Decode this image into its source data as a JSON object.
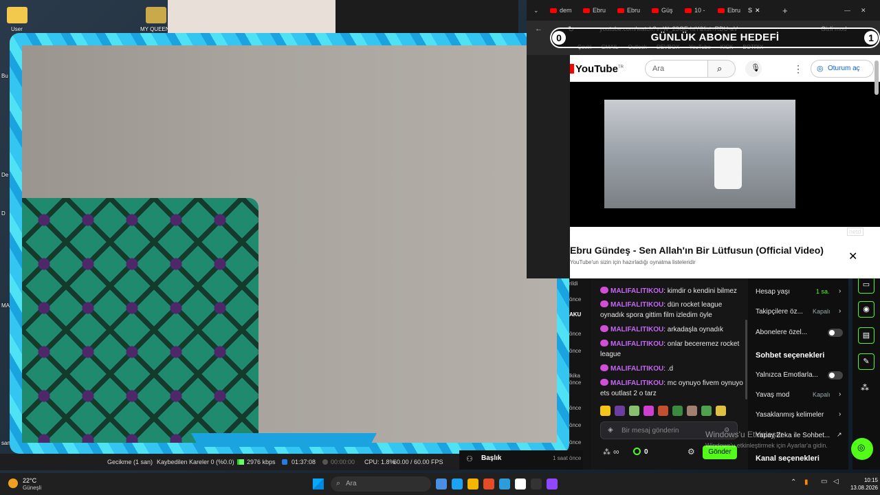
{
  "desktop": {
    "icon1_label": "User",
    "icon2_label": "MY QUEENS",
    "side_labels": [
      "Bu",
      "De",
      "D",
      "MA",
      "san"
    ]
  },
  "goal": {
    "left_count": "0",
    "title": "GÜNLÜK ABONE HEDEFİ",
    "right_count": "1"
  },
  "browser": {
    "tabs": [
      "dem",
      "Ebru",
      "Ebru",
      "Güş",
      "10 -",
      "Ebru",
      "S"
    ],
    "url": "youtube.com/watch?v=W_23GE-htY&list=RDU-aV",
    "profile": "Gizli mod",
    "bookmarks": [
      "Çeviri",
      "GMAIL",
      "Outlook",
      "DEVBOX",
      "YouTube",
      "KICK",
      "BOTRIX"
    ]
  },
  "youtube": {
    "logo": "YouTube",
    "region": "TR",
    "search_placeholder": "Ara",
    "signin": "Oturum aç",
    "watermark": "netd",
    "video_title": "Ebru Gündeş - Sen Allah'ın Bir Lütfusun (Official Video)",
    "mix_sub": "YouTube'un sizin için hazırladığı oynatma listeleridir"
  },
  "chat_strip": [
    "rildi",
    "önce",
    "AKU",
    "önce",
    "önce",
    "lkika",
    "önce",
    "önce",
    "önce",
    "önce"
  ],
  "chat": {
    "messages": [
      {
        "user": "MALIFALITIKOU",
        "text": ": kimdir o kendini bilmez"
      },
      {
        "user": "MALIFALITIKOU",
        "text": ": dün rocket league oynadık spora gittim film izledim öyle"
      },
      {
        "user": "MALIFALITIKOU",
        "text": ": arkadaşla oynadık"
      },
      {
        "user": "MALIFALITIKOU",
        "text": ": onlar beceremez rocket league"
      },
      {
        "user": "MALIFALITIKOU",
        "text": ": .d"
      },
      {
        "user": "MALIFALITIKOU",
        "text": ": mc oynuyo fivem oynuyo ets outlast 2 o tarz"
      }
    ],
    "emote_colors": [
      "#f5c518",
      "#6a3fa0",
      "#88c070",
      "#d040d0",
      "#c05030",
      "#3a8a40",
      "#a08070",
      "#50a050",
      "#e0c040"
    ],
    "input_placeholder": "Bir mesaj gönderin",
    "infinity": "∞",
    "points": "0",
    "send_label": "Gönder"
  },
  "settings": {
    "account_age_label": "Hesap yaşı",
    "account_age_value": "1 sa.",
    "followers_label": "Takipçilere öz...",
    "followers_value": "Kapalı",
    "subs_label": "Abonelere özel...",
    "chat_options_head": "Sohbet seçenekleri",
    "emote_only_label": "Yalnızca Emotlarla...",
    "slow_mode_label": "Yavaş mod",
    "slow_mode_value": "Kapalı",
    "banned_words_label": "Yasaklanmış kelimeler",
    "ai_label": "Yapay Zeka ile Sohbet...",
    "channel_options_head": "Kanal seçenekleri"
  },
  "titlebar": {
    "label": "Başlık",
    "time": "1 saat önce"
  },
  "obs": {
    "latency": "Gecikme (1 san)",
    "dropped": "Kaybedilen Kareler 0 (%0.0)",
    "bitrate": "2976 kbps",
    "live_time": "01:37:08",
    "rec_time": "00:00:00",
    "cpu": "CPU: 1.8%",
    "fps": "60.00 / 60.00 FPS"
  },
  "windows_watermark": {
    "line1": "Windows'u Etkinleştir",
    "line2": "Windows'u etkinleştirmek için Ayarlar'a gidin."
  },
  "taskbar": {
    "temp": "22°C",
    "weather": "Güneşli",
    "search_placeholder": "Ara",
    "time": "10:15",
    "date": "13.08.2026",
    "app_colors": [
      "#4a90e2",
      "#1da1f2",
      "#f4b400",
      "#e34c26",
      "#2d9cdb",
      "#ffffff",
      "#333333",
      "#9146ff"
    ]
  },
  "colors": {
    "kick_green": "#53fc18",
    "chat_user": "#c567f5",
    "cam_border": "#34c6f0"
  }
}
